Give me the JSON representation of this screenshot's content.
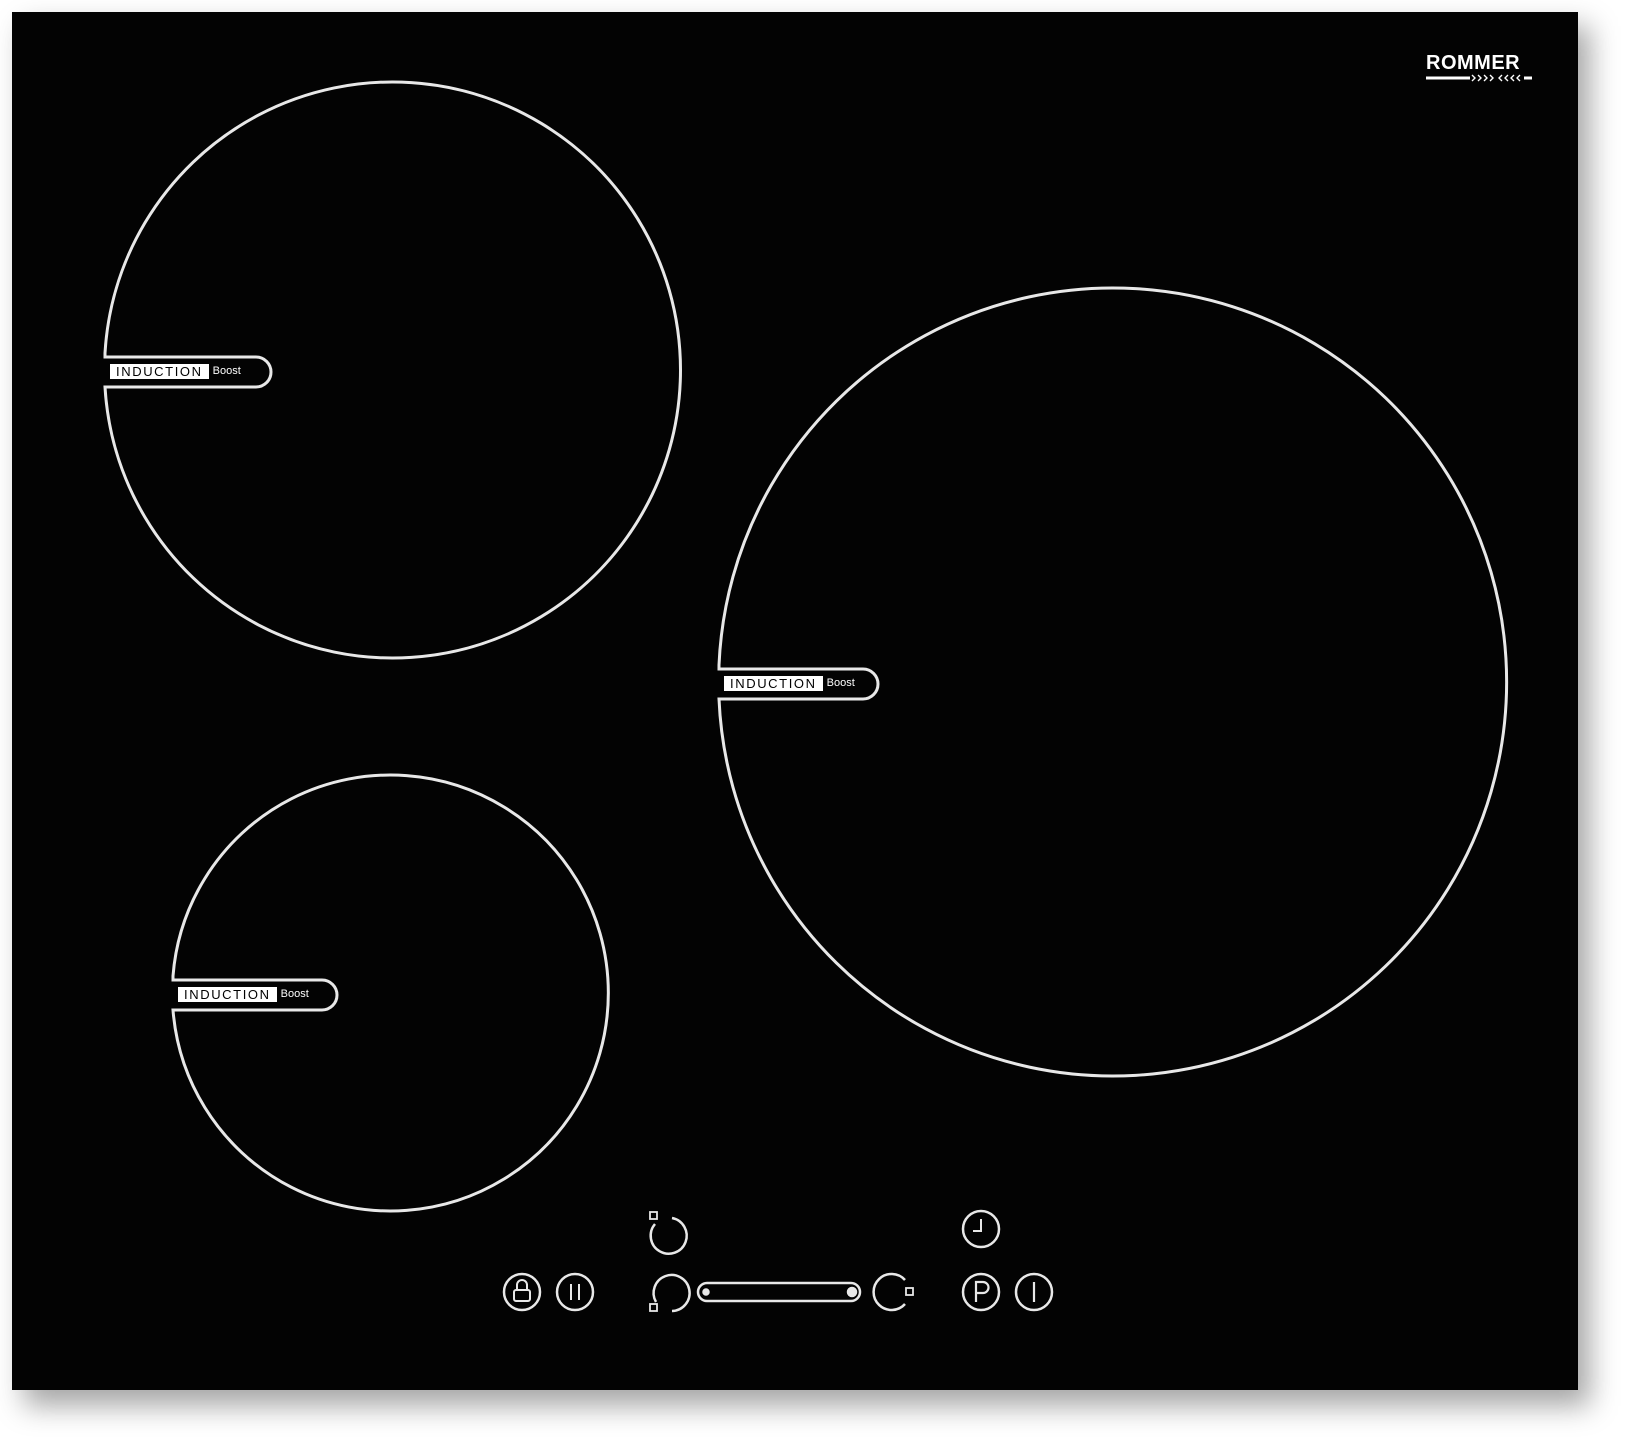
{
  "brand": {
    "name": "ROMMER",
    "color": "#ffffff"
  },
  "surface": {
    "color": "#030303",
    "line_color": "#e8e8e8"
  },
  "zones": [
    {
      "id": "top-left",
      "label": "INDUCTION",
      "badge": "Boost"
    },
    {
      "id": "right",
      "label": "INDUCTION",
      "badge": "Boost"
    },
    {
      "id": "bottom-left",
      "label": "INDUCTION",
      "badge": "Boost"
    }
  ],
  "controls": {
    "lock": {
      "icon": "lock-icon"
    },
    "pause": {
      "icon": "pause-icon"
    },
    "zone_select_top": {
      "icon": "zone-select-icon"
    },
    "minus": {
      "icon": "power-decrease-icon"
    },
    "slider": {
      "icon": "power-slider"
    },
    "plus": {
      "icon": "power-increase-icon"
    },
    "timer": {
      "icon": "clock-icon"
    },
    "boost": {
      "icon": "p-letter-icon"
    },
    "power": {
      "icon": "power-icon"
    }
  }
}
